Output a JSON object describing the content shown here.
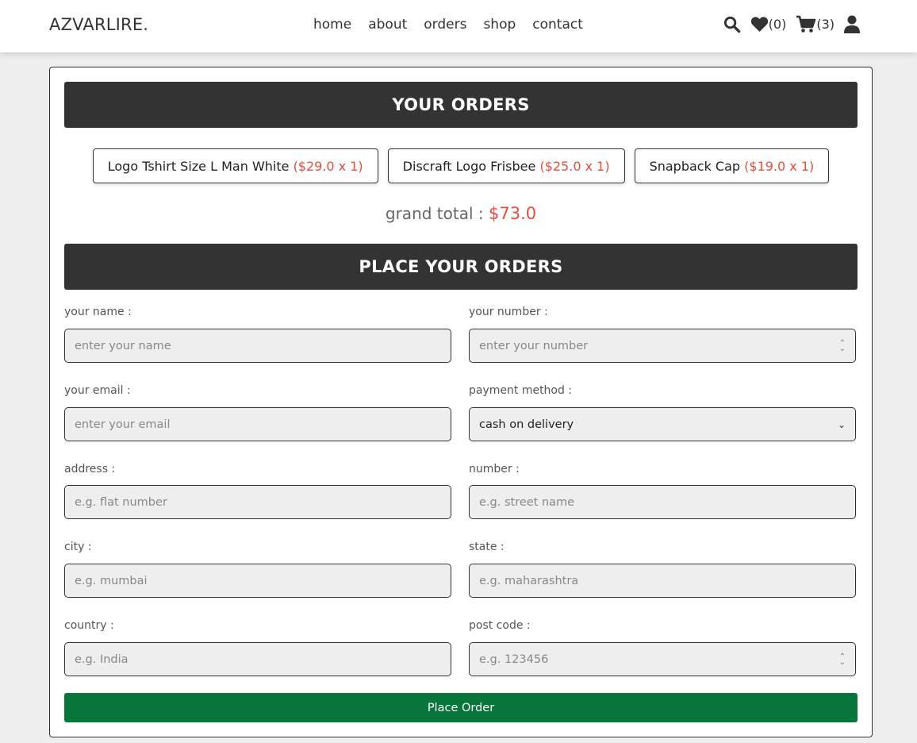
{
  "header": {
    "logo": "AZVARLIRE.",
    "nav": [
      "home",
      "about",
      "orders",
      "shop",
      "contact"
    ],
    "wishlist_count": "(0)",
    "cart_count": "(3)"
  },
  "orders": {
    "title": "YOUR ORDERS",
    "items": [
      {
        "name": "Logo Tshirt Size L Man White",
        "price": "($29.0 x 1)"
      },
      {
        "name": "Discraft Logo Frisbee",
        "price": "($25.0 x 1)"
      },
      {
        "name": "Snapback Cap",
        "price": "($19.0 x 1)"
      }
    ],
    "grand_total_label": "grand total :",
    "grand_total_value": "$73.0"
  },
  "form": {
    "title": "PLACE YOUR ORDERS",
    "name": {
      "label": "your name :",
      "placeholder": "enter your name"
    },
    "number": {
      "label": "your number :",
      "placeholder": "enter your number"
    },
    "email": {
      "label": "your email :",
      "placeholder": "enter your email"
    },
    "payment": {
      "label": "payment method :",
      "value": "cash on delivery"
    },
    "address": {
      "label": "address :",
      "placeholder": "e.g. flat number"
    },
    "street": {
      "label": "number :",
      "placeholder": "e.g. street name"
    },
    "city": {
      "label": "city :",
      "placeholder": "e.g. mumbai"
    },
    "state": {
      "label": "state :",
      "placeholder": "e.g. maharashtra"
    },
    "country": {
      "label": "country :",
      "placeholder": "e.g. India"
    },
    "postcode": {
      "label": "post code :",
      "placeholder": "e.g. 123456"
    },
    "submit_label": "Place Order"
  },
  "colors": {
    "accent_red": "#e74c3c",
    "dark_bar": "#333333",
    "button_green": "#08763b"
  }
}
